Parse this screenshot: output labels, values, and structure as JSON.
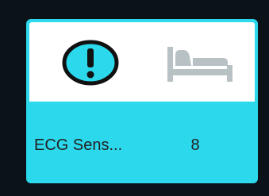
{
  "card": {
    "alert_icon": "exclamation-circle-icon",
    "status_icon": "bed-icon",
    "sensor_name": "ECG Sens...",
    "sensor_value": "8"
  },
  "colors": {
    "background": "#0b1218",
    "card_accent": "#2bd8ec",
    "card_top": "#ffffff",
    "alert_fill": "#2bd8ec",
    "alert_stroke": "#111111",
    "bed_icon": "#b8c1c4",
    "text": "#222222"
  }
}
